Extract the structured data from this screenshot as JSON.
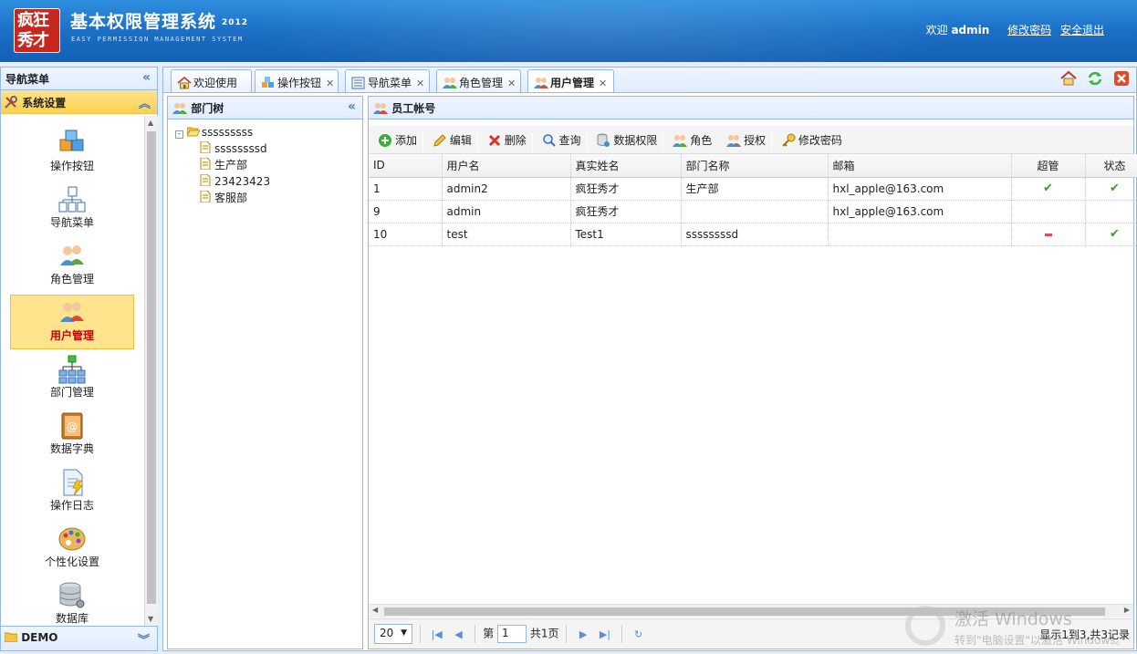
{
  "header": {
    "logo_text": "疯狂秀才",
    "title": "基本权限管理系统",
    "year": "2012",
    "subtitle": "EASY PERMISSION MANAGEMENT SYSTEM",
    "welcome": "欢迎",
    "username": "admin",
    "change_password": "修改密码",
    "logout": "安全退出"
  },
  "nav": {
    "title": "导航菜单",
    "section": "系统设置",
    "items": [
      {
        "label": "操作按钮",
        "icon": "cubes-icon"
      },
      {
        "label": "导航菜单",
        "icon": "sitemap-icon"
      },
      {
        "label": "角色管理",
        "icon": "users-icon"
      },
      {
        "label": "用户管理",
        "icon": "user-group-icon",
        "active": true
      },
      {
        "label": "部门管理",
        "icon": "org-chart-icon"
      },
      {
        "label": "数据字典",
        "icon": "address-book-icon"
      },
      {
        "label": "操作日志",
        "icon": "log-icon"
      },
      {
        "label": "个性化设置",
        "icon": "palette-icon"
      },
      {
        "label": "数据库",
        "icon": "database-icon"
      }
    ],
    "demo": "DEMO"
  },
  "tabs": [
    {
      "label": "欢迎使用",
      "closable": false
    },
    {
      "label": "操作按钮",
      "closable": true
    },
    {
      "label": "导航菜单",
      "closable": true
    },
    {
      "label": "角色管理",
      "closable": true
    },
    {
      "label": "用户管理",
      "closable": true,
      "active": true
    }
  ],
  "dept_tree": {
    "title": "部门树",
    "root": "sssssssss",
    "children": [
      "ssssssssd",
      "生产部",
      "23423423",
      "客服部"
    ]
  },
  "users": {
    "title": "员工帐号",
    "toolbar": [
      "添加",
      "编辑",
      "删除",
      "查询",
      "数据权限",
      "角色",
      "授权",
      "修改密码"
    ],
    "columns": [
      "ID",
      "用户名",
      "真实姓名",
      "部门名称",
      "邮箱",
      "超管",
      "状态"
    ],
    "rows": [
      {
        "id": "1",
        "username": "admin2",
        "realname": "疯狂秀才",
        "dept": "生产部",
        "email": "hxl_apple@163.com",
        "admin": "yes",
        "status": "yes"
      },
      {
        "id": "9",
        "username": "admin",
        "realname": "疯狂秀才",
        "dept": "",
        "email": "hxl_apple@163.com",
        "admin": "",
        "status": ""
      },
      {
        "id": "10",
        "username": "test",
        "realname": "Test1",
        "dept": "ssssssssd",
        "email": "",
        "admin": "no",
        "status": "yes"
      }
    ]
  },
  "pager": {
    "page_size": "20",
    "page_prefix": "第",
    "page": "1",
    "page_total": "共1页",
    "info": "显示1到3,共3记录"
  },
  "watermark": {
    "line1": "激活 Windows",
    "line2": "转到\"电脑设置\"以激活 Windows。"
  },
  "colors": {
    "header": "#1b6fc5",
    "border": "#95b8e7",
    "active_item": "#ffe48d",
    "check": "#3a9d23",
    "minus": "#e8465b"
  }
}
